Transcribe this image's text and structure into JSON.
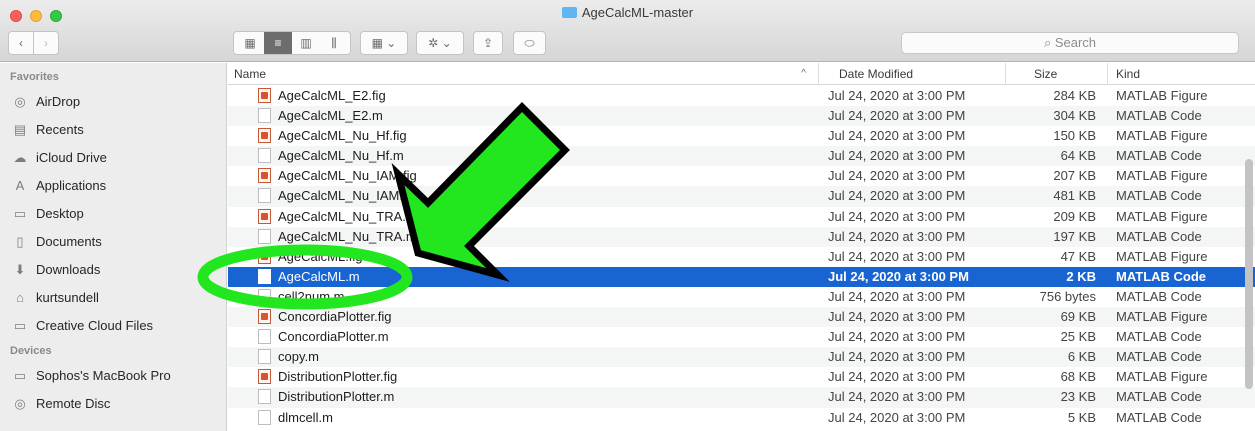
{
  "window": {
    "title": "AgeCalcML-master"
  },
  "toolbar": {
    "back": "‹",
    "forward": "›",
    "view_icons": [
      "▦",
      "≡",
      "▥",
      "⫼"
    ],
    "arrange": "▦ ⌄",
    "action": "✲ ⌄",
    "share": "⇪",
    "tags": "⬭",
    "search_placeholder": "Search"
  },
  "sidebar": {
    "favorites_heading": "Favorites",
    "favorites": [
      {
        "label": "AirDrop",
        "icon": "airdrop-icon",
        "glyph": "◎"
      },
      {
        "label": "Recents",
        "icon": "recents-icon",
        "glyph": "▤"
      },
      {
        "label": "iCloud Drive",
        "icon": "cloud-icon",
        "glyph": "☁"
      },
      {
        "label": "Applications",
        "icon": "applications-icon",
        "glyph": "A"
      },
      {
        "label": "Desktop",
        "icon": "desktop-icon",
        "glyph": "▭"
      },
      {
        "label": "Documents",
        "icon": "documents-icon",
        "glyph": "▯"
      },
      {
        "label": "Downloads",
        "icon": "downloads-icon",
        "glyph": "⬇"
      },
      {
        "label": "kurtsundell",
        "icon": "home-icon",
        "glyph": "⌂"
      },
      {
        "label": "Creative Cloud Files",
        "icon": "folder-icon",
        "glyph": "▭"
      }
    ],
    "devices_heading": "Devices",
    "devices": [
      {
        "label": "Sophos's MacBook Pro",
        "icon": "laptop-icon",
        "glyph": "▭"
      },
      {
        "label": "Remote Disc",
        "icon": "disc-icon",
        "glyph": "◎"
      }
    ]
  },
  "columns": {
    "name": "Name",
    "date": "Date Modified",
    "size": "Size",
    "kind": "Kind",
    "sort": "^"
  },
  "files": [
    {
      "name": "AgeCalcML_E2.fig",
      "date": "Jul 24, 2020 at 3:00 PM",
      "size": "284 KB",
      "kind": "MATLAB Figure",
      "type": "fig"
    },
    {
      "name": "AgeCalcML_E2.m",
      "date": "Jul 24, 2020 at 3:00 PM",
      "size": "304 KB",
      "kind": "MATLAB Code",
      "type": "m"
    },
    {
      "name": "AgeCalcML_Nu_Hf.fig",
      "date": "Jul 24, 2020 at 3:00 PM",
      "size": "150 KB",
      "kind": "MATLAB Figure",
      "type": "fig"
    },
    {
      "name": "AgeCalcML_Nu_Hf.m",
      "date": "Jul 24, 2020 at 3:00 PM",
      "size": "64 KB",
      "kind": "MATLAB Code",
      "type": "m"
    },
    {
      "name": "AgeCalcML_Nu_IAM.fig",
      "date": "Jul 24, 2020 at 3:00 PM",
      "size": "207 KB",
      "kind": "MATLAB Figure",
      "type": "fig"
    },
    {
      "name": "AgeCalcML_Nu_IAM.m",
      "date": "Jul 24, 2020 at 3:00 PM",
      "size": "481 KB",
      "kind": "MATLAB Code",
      "type": "m"
    },
    {
      "name": "AgeCalcML_Nu_TRA.fig",
      "date": "Jul 24, 2020 at 3:00 PM",
      "size": "209 KB",
      "kind": "MATLAB Figure",
      "type": "fig"
    },
    {
      "name": "AgeCalcML_Nu_TRA.m",
      "date": "Jul 24, 2020 at 3:00 PM",
      "size": "197 KB",
      "kind": "MATLAB Code",
      "type": "m"
    },
    {
      "name": "AgeCalcML.fig",
      "date": "Jul 24, 2020 at 3:00 PM",
      "size": "47 KB",
      "kind": "MATLAB Figure",
      "type": "fig"
    },
    {
      "name": "AgeCalcML.m",
      "date": "Jul 24, 2020 at 3:00 PM",
      "size": "2 KB",
      "kind": "MATLAB Code",
      "type": "m",
      "selected": true
    },
    {
      "name": "cell2num.m",
      "date": "Jul 24, 2020 at 3:00 PM",
      "size": "756 bytes",
      "kind": "MATLAB Code",
      "type": "m"
    },
    {
      "name": "ConcordiaPlotter.fig",
      "date": "Jul 24, 2020 at 3:00 PM",
      "size": "69 KB",
      "kind": "MATLAB Figure",
      "type": "fig"
    },
    {
      "name": "ConcordiaPlotter.m",
      "date": "Jul 24, 2020 at 3:00 PM",
      "size": "25 KB",
      "kind": "MATLAB Code",
      "type": "m"
    },
    {
      "name": "copy.m",
      "date": "Jul 24, 2020 at 3:00 PM",
      "size": "6 KB",
      "kind": "MATLAB Code",
      "type": "m"
    },
    {
      "name": "DistributionPlotter.fig",
      "date": "Jul 24, 2020 at 3:00 PM",
      "size": "68 KB",
      "kind": "MATLAB Figure",
      "type": "fig"
    },
    {
      "name": "DistributionPlotter.m",
      "date": "Jul 24, 2020 at 3:00 PM",
      "size": "23 KB",
      "kind": "MATLAB Code",
      "type": "m"
    },
    {
      "name": "dlmcell.m",
      "date": "Jul 24, 2020 at 3:00 PM",
      "size": "5 KB",
      "kind": "MATLAB Code",
      "type": "m"
    }
  ],
  "annotation": {
    "color": "#22e61e",
    "outline": "#000000",
    "arrow": "green-arrow",
    "ring": "green-circle"
  },
  "colors": {
    "selection": "#1764d2",
    "sidebar": "#ededed"
  }
}
